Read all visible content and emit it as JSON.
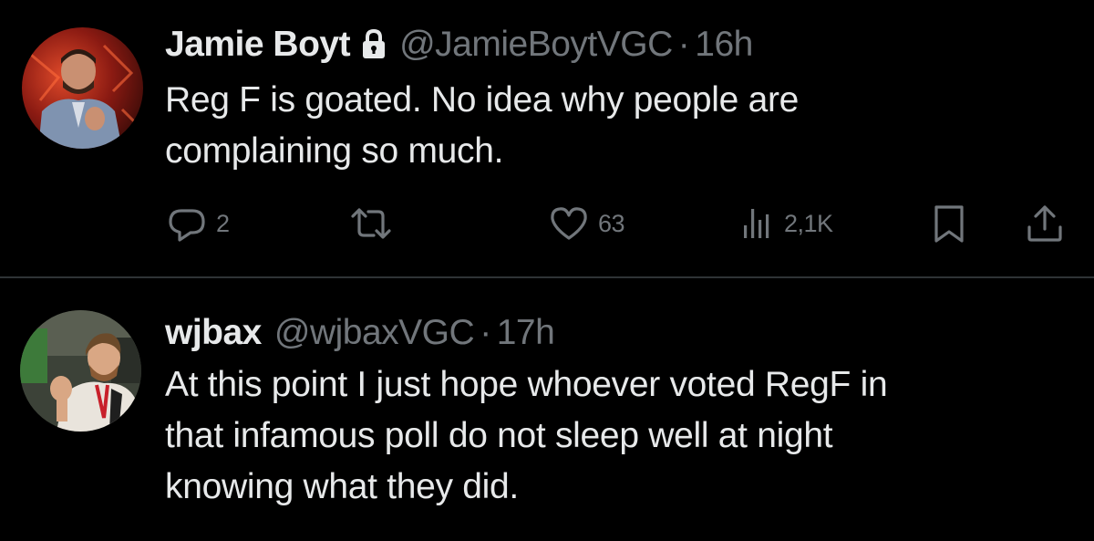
{
  "tweets": [
    {
      "author": {
        "name": "Jamie Boyt",
        "protected": true,
        "lock_icon": "lock-icon",
        "handle": "@JamieBoytVGC",
        "time": "16h"
      },
      "text": "Reg F is goated. No idea why people are\ncomplaining so much.",
      "actions": {
        "replies": "2",
        "retweets": "",
        "likes": "63",
        "views": "2,1K"
      }
    },
    {
      "author": {
        "name": "wjbax",
        "protected": false,
        "handle": "@wjbaxVGC",
        "time": "17h"
      },
      "text": "At this point I just hope whoever voted RegF in\nthat infamous poll do not sleep well at night\nknowing what they did."
    }
  ],
  "separator": "·",
  "icons": {
    "reply": "reply-icon",
    "retweet": "retweet-icon",
    "like": "heart-icon",
    "views": "views-icon",
    "bookmark": "bookmark-icon",
    "share": "share-icon"
  },
  "colors": {
    "background": "#000000",
    "text_primary": "#e7e9ea",
    "text_secondary": "#71767b",
    "divider": "#2f3336"
  }
}
